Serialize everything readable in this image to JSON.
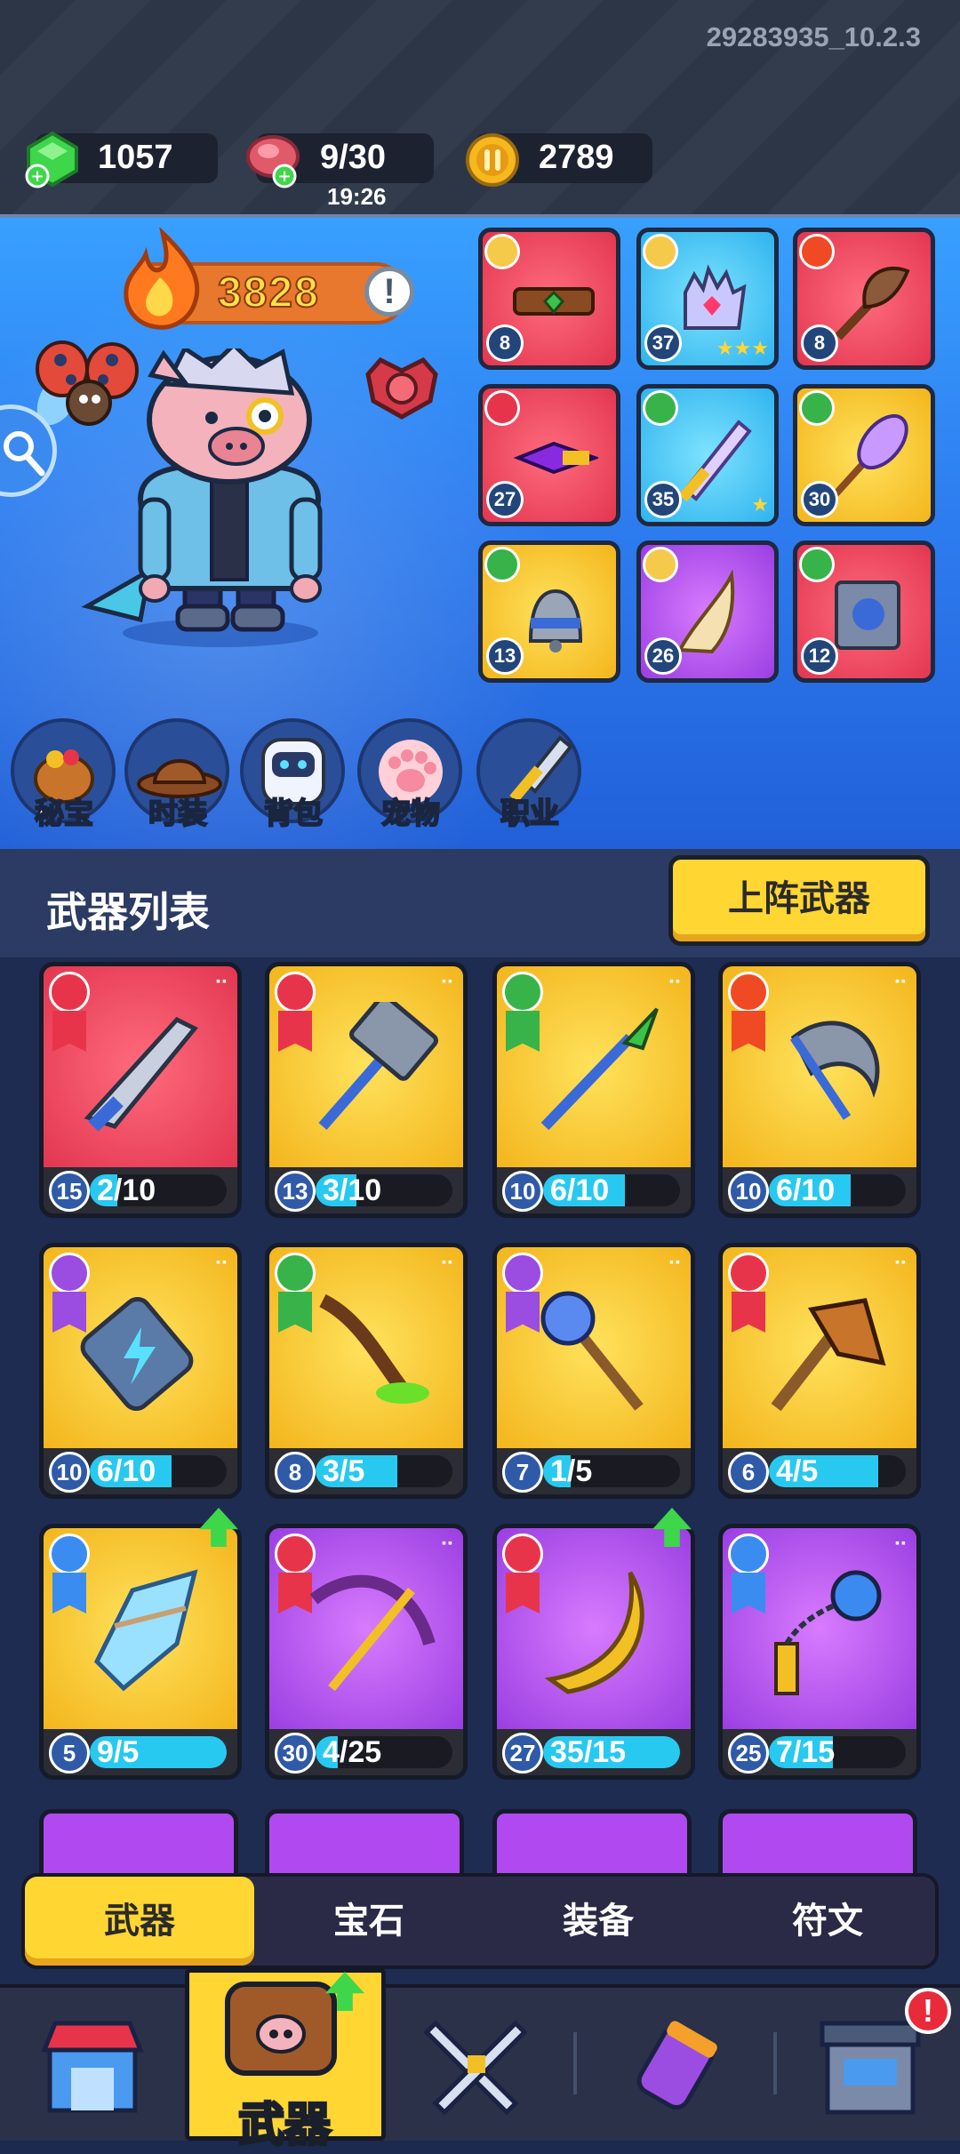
{
  "version": "29283935_10.2.3",
  "resources": {
    "gems": "1057",
    "stamina": "9/30",
    "stamina_timer": "19:26",
    "coins": "2789"
  },
  "hero": {
    "power": "3828",
    "power_info": "!"
  },
  "equipment": [
    {
      "level": "8",
      "icon": "belt-icon",
      "color": "red"
    },
    {
      "level": "37",
      "icon": "glove-icon",
      "color": "blue"
    },
    {
      "level": "8",
      "icon": "duster-icon",
      "color": "red"
    },
    {
      "level": "27",
      "icon": "purple-dagger-icon",
      "color": "red"
    },
    {
      "level": "35",
      "icon": "crystal-blade-icon",
      "color": "blue"
    },
    {
      "level": "30",
      "icon": "feather-staff-icon",
      "color": "gold"
    },
    {
      "level": "13",
      "icon": "bell-icon",
      "color": "gold"
    },
    {
      "level": "26",
      "icon": "horn-icon",
      "color": "purple"
    },
    {
      "level": "12",
      "icon": "spellbook-icon",
      "color": "red"
    }
  ],
  "side_menu": [
    {
      "label": "秘宝",
      "icon": "treasure-icon"
    },
    {
      "label": "时装",
      "icon": "hat-icon"
    },
    {
      "label": "背包",
      "icon": "backpack-icon"
    },
    {
      "label": "宠物",
      "icon": "paw-icon"
    },
    {
      "label": "职业",
      "icon": "sword-class-icon"
    }
  ],
  "weapon_list": {
    "title": "武器列表",
    "deploy_button": "上阵武器"
  },
  "weapons": [
    {
      "level": "15",
      "count": "2/10",
      "progress": 0.2,
      "icon": "knife-icon",
      "color": "red",
      "element": "#e8344a"
    },
    {
      "level": "13",
      "count": "3/10",
      "progress": 0.3,
      "icon": "hammer-icon",
      "color": "gold",
      "element": "#e8344a"
    },
    {
      "level": "10",
      "count": "6/10",
      "progress": 0.6,
      "icon": "spear-icon",
      "color": "gold",
      "element": "#38b34a"
    },
    {
      "level": "10",
      "count": "6/10",
      "progress": 0.6,
      "icon": "scythe-icon",
      "color": "gold",
      "element": "#f04a24"
    },
    {
      "level": "10",
      "count": "6/10",
      "progress": 0.6,
      "icon": "battery-icon",
      "color": "gold",
      "element": "#9a4de0"
    },
    {
      "level": "8",
      "count": "3/5",
      "progress": 0.6,
      "icon": "slime-stick-icon",
      "color": "gold",
      "element": "#38b34a"
    },
    {
      "level": "7",
      "count": "1/5",
      "progress": 0.2,
      "icon": "orb-staff-icon",
      "color": "gold",
      "element": "#9a4de0"
    },
    {
      "level": "6",
      "count": "4/5",
      "progress": 0.8,
      "icon": "axe-icon",
      "color": "gold",
      "element": "#e8344a"
    },
    {
      "level": "5",
      "count": "9/5",
      "progress": 1.0,
      "icon": "ice-crystal-icon",
      "color": "gold",
      "element": "#3a8cf0"
    },
    {
      "level": "30",
      "count": "4/25",
      "progress": 0.16,
      "icon": "crossbow-icon",
      "color": "purple",
      "element": "#e8344a"
    },
    {
      "level": "27",
      "count": "35/15",
      "progress": 1.0,
      "icon": "boomerang-icon",
      "color": "purple",
      "element": "#e8344a"
    },
    {
      "level": "25",
      "count": "7/15",
      "progress": 0.47,
      "icon": "flail-icon",
      "color": "purple",
      "element": "#3a8cf0"
    }
  ],
  "tabs": [
    "武器",
    "宝石",
    "装备",
    "符文"
  ],
  "nav": {
    "selected_label": "武器",
    "alert": "!"
  }
}
